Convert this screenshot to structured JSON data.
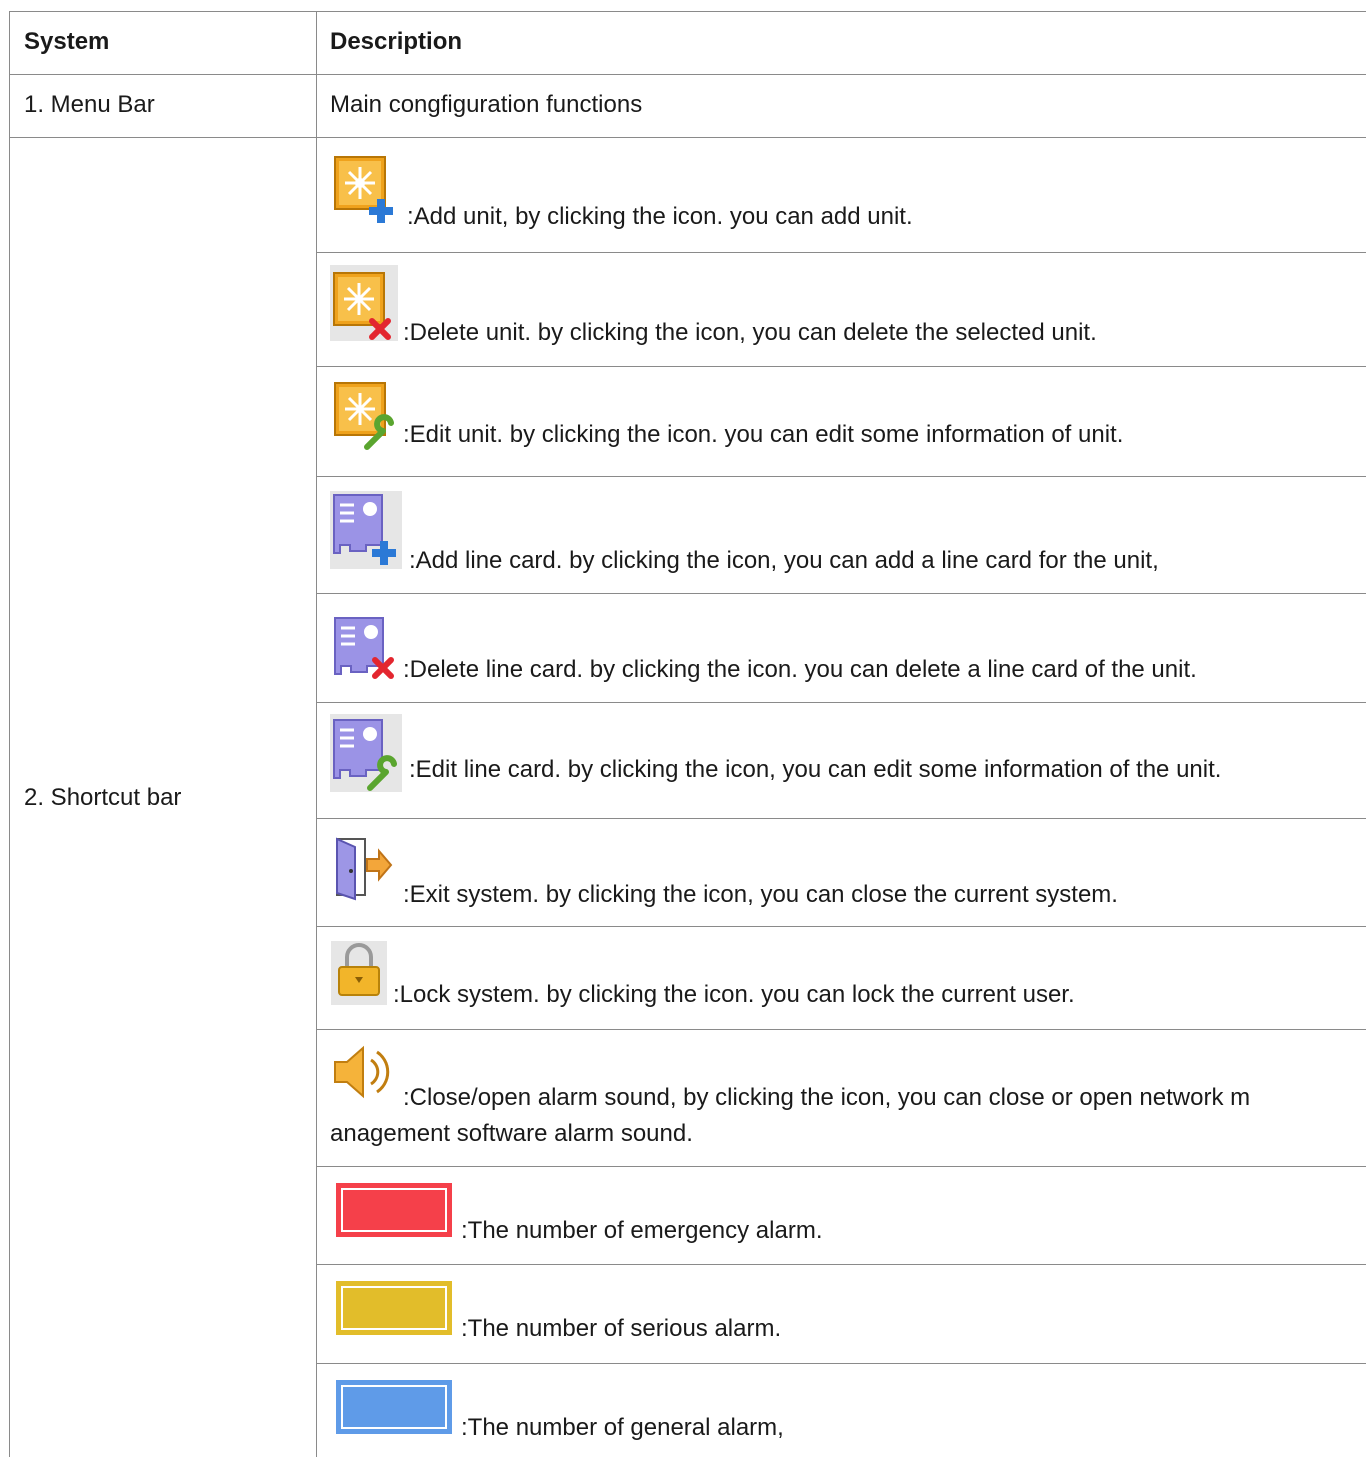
{
  "table": {
    "header": {
      "system": "System",
      "description": "Description"
    },
    "menu_bar": {
      "system": "1. Menu Bar",
      "description": "Main congfiguration functions"
    },
    "shortcut_bar": {
      "system": "2. Shortcut bar",
      "items": [
        {
          "icon": "add-unit-icon",
          "text": ":Add unit, by clicking the icon. you can add unit."
        },
        {
          "icon": "delete-unit-icon",
          "text": ":Delete unit. by clicking the icon, you can delete the selected unit."
        },
        {
          "icon": "edit-unit-icon",
          "text": ":Edit unit. by clicking the icon. you can edit some information of unit."
        },
        {
          "icon": "add-line-card-icon",
          "text": ":Add line card. by clicking the icon, you can add a line card for the unit,"
        },
        {
          "icon": "delete-line-card-icon",
          "text": ":Delete line card. by clicking the icon. you can delete a line card of the unit."
        },
        {
          "icon": "edit-line-card-icon",
          "text": ":Edit line card. by clicking the icon, you can edit some information of the unit."
        },
        {
          "icon": "exit-system-icon",
          "text": ":Exit system. by clicking the icon, you can close the current system."
        },
        {
          "icon": "lock-system-icon",
          "text": ":Lock system. by clicking the icon. you can lock the current user."
        },
        {
          "icon": "alarm-sound-icon",
          "text": ":Close/open alarm sound, by clicking the icon, you can close or open network m",
          "text2": "anagement software alarm sound."
        },
        {
          "icon": "emergency-alarm-swatch",
          "text": ":The number of emergency alarm.",
          "color": "#f5404a"
        },
        {
          "icon": "serious-alarm-swatch",
          "text": ":The number of serious alarm.",
          "color": "#e2bd2a"
        },
        {
          "icon": "general-alarm-swatch",
          "text": ":The number of general alarm,",
          "color": "#5f9be8"
        }
      ]
    }
  }
}
